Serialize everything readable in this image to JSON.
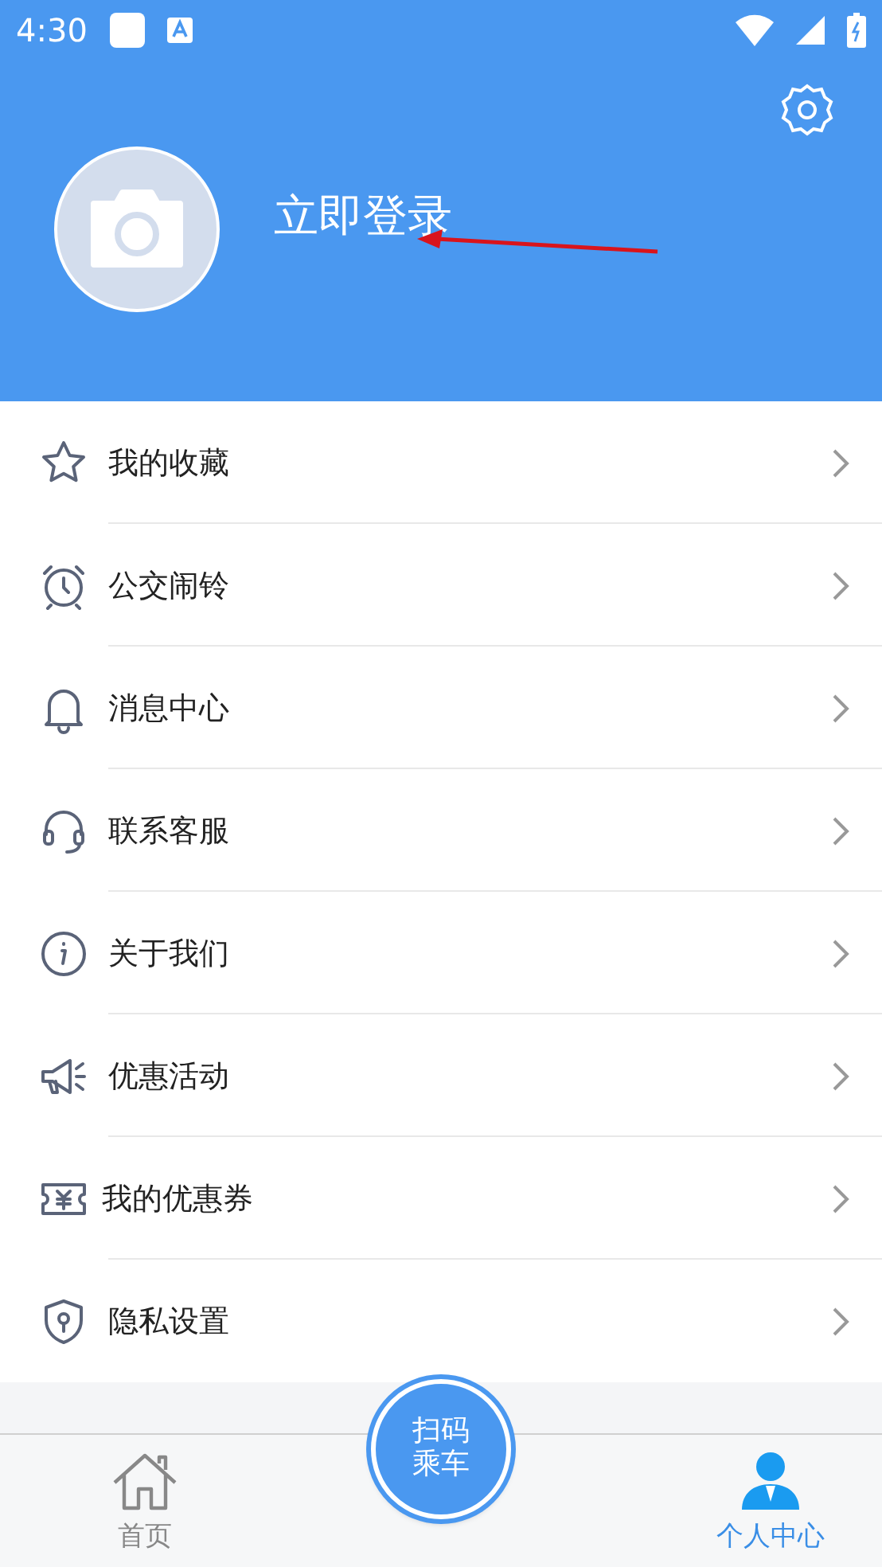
{
  "status_bar": {
    "time": "4:30"
  },
  "profile": {
    "login_label": "立即登录"
  },
  "menu": [
    {
      "label": "我的收藏"
    },
    {
      "label": "公交闹铃"
    },
    {
      "label": "消息中心"
    },
    {
      "label": "联系客服"
    },
    {
      "label": "关于我们"
    },
    {
      "label": "优惠活动"
    },
    {
      "label": "我的优惠券"
    },
    {
      "label": "隐私设置"
    }
  ],
  "scan_button": {
    "lines": [
      "扫码",
      "乘车"
    ]
  },
  "tabs": [
    {
      "label": "首页",
      "selected": false
    },
    {
      "label": "个人中心",
      "selected": true
    }
  ]
}
